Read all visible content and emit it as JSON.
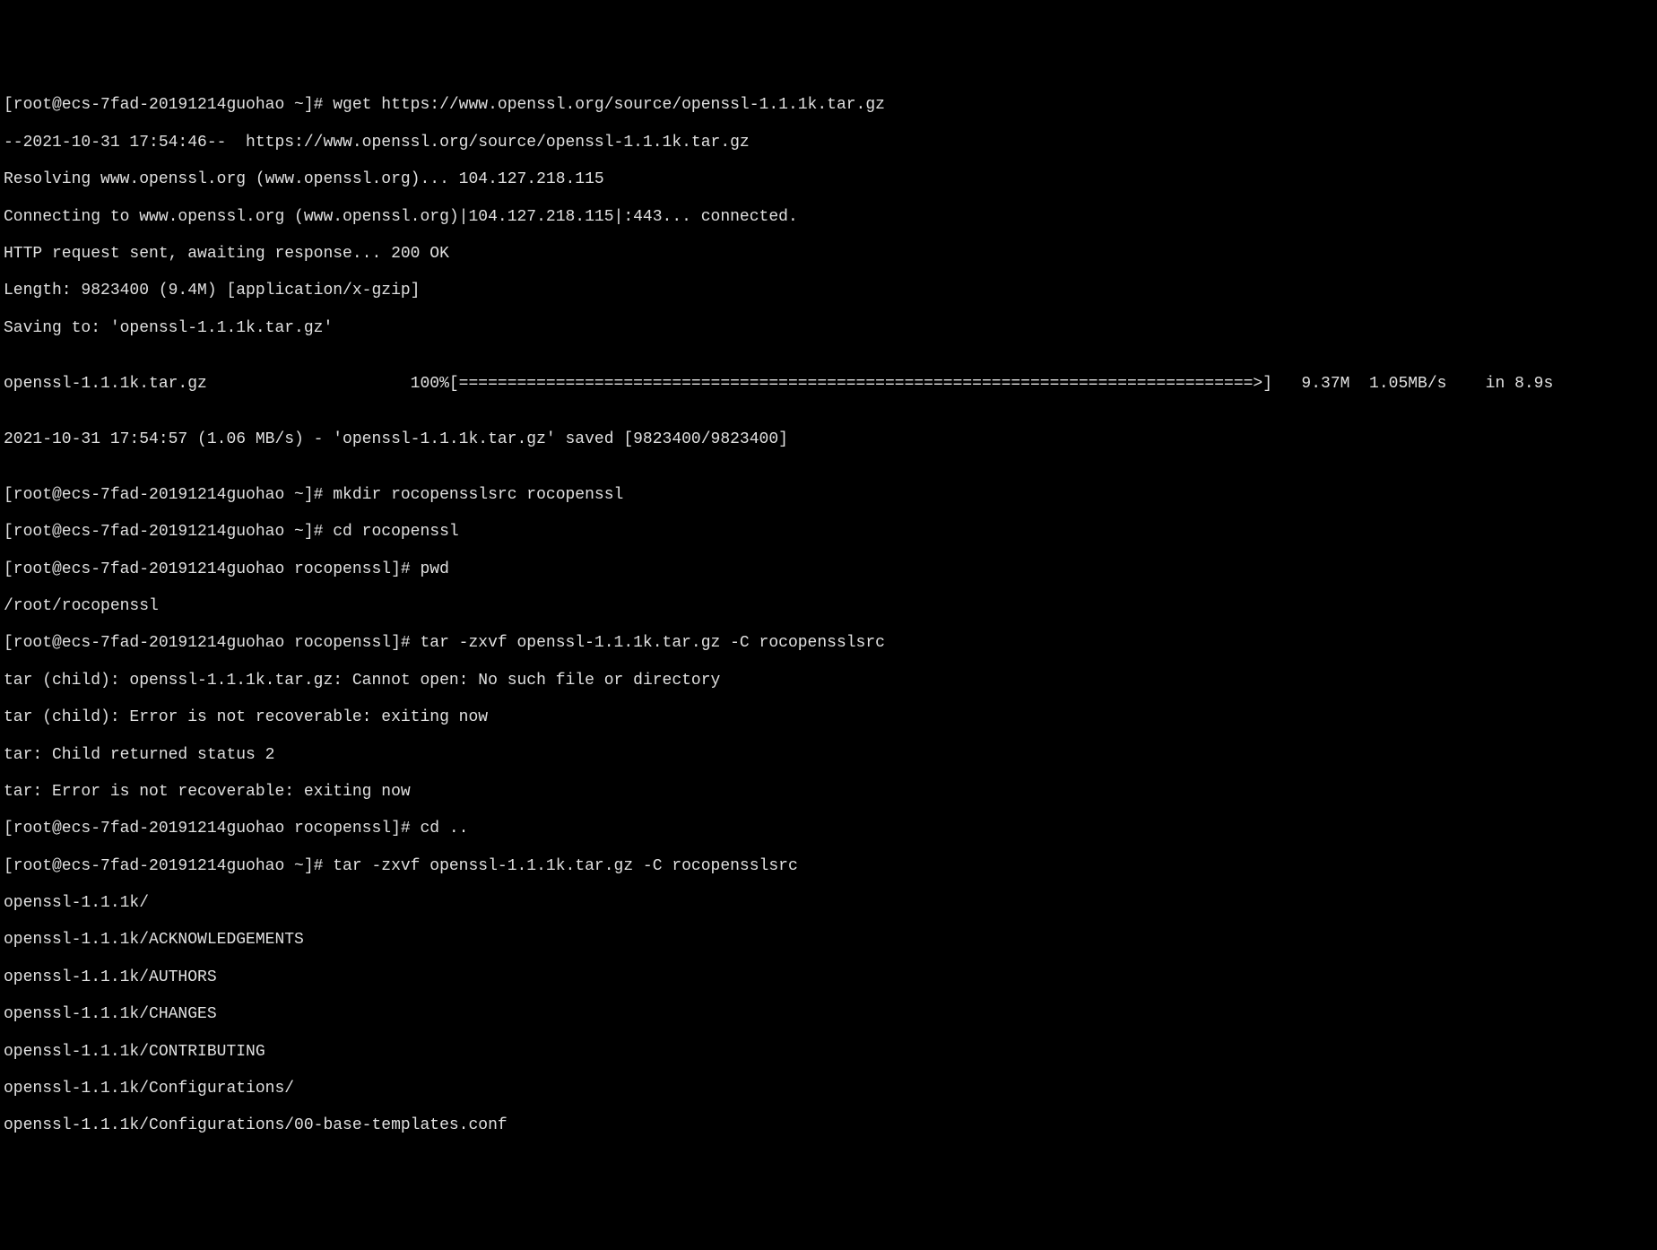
{
  "lines": [
    "[root@ecs-7fad-20191214guohao ~]# wget https://www.openssl.org/source/openssl-1.1.1k.tar.gz",
    "--2021-10-31 17:54:46--  https://www.openssl.org/source/openssl-1.1.1k.tar.gz",
    "Resolving www.openssl.org (www.openssl.org)... 104.127.218.115",
    "Connecting to www.openssl.org (www.openssl.org)|104.127.218.115|:443... connected.",
    "HTTP request sent, awaiting response... 200 OK",
    "Length: 9823400 (9.4M) [application/x-gzip]",
    "Saving to: 'openssl-1.1.1k.tar.gz'",
    "",
    "openssl-1.1.1k.tar.gz                     100%[==================================================================================>]   9.37M  1.05MB/s    in 8.9s",
    "",
    "2021-10-31 17:54:57 (1.06 MB/s) - 'openssl-1.1.1k.tar.gz' saved [9823400/9823400]",
    "",
    "[root@ecs-7fad-20191214guohao ~]# mkdir rocopensslsrc rocopenssl",
    "[root@ecs-7fad-20191214guohao ~]# cd rocopenssl",
    "[root@ecs-7fad-20191214guohao rocopenssl]# pwd",
    "/root/rocopenssl",
    "[root@ecs-7fad-20191214guohao rocopenssl]# tar -zxvf openssl-1.1.1k.tar.gz -C rocopensslsrc",
    "tar (child): openssl-1.1.1k.tar.gz: Cannot open: No such file or directory",
    "tar (child): Error is not recoverable: exiting now",
    "tar: Child returned status 2",
    "tar: Error is not recoverable: exiting now",
    "[root@ecs-7fad-20191214guohao rocopenssl]# cd ..",
    "[root@ecs-7fad-20191214guohao ~]# tar -zxvf openssl-1.1.1k.tar.gz -C rocopensslsrc",
    "openssl-1.1.1k/",
    "openssl-1.1.1k/ACKNOWLEDGEMENTS",
    "openssl-1.1.1k/AUTHORS",
    "openssl-1.1.1k/CHANGES",
    "openssl-1.1.1k/CONTRIBUTING",
    "openssl-1.1.1k/Configurations/",
    "openssl-1.1.1k/Configurations/00-base-templates.conf"
  ]
}
